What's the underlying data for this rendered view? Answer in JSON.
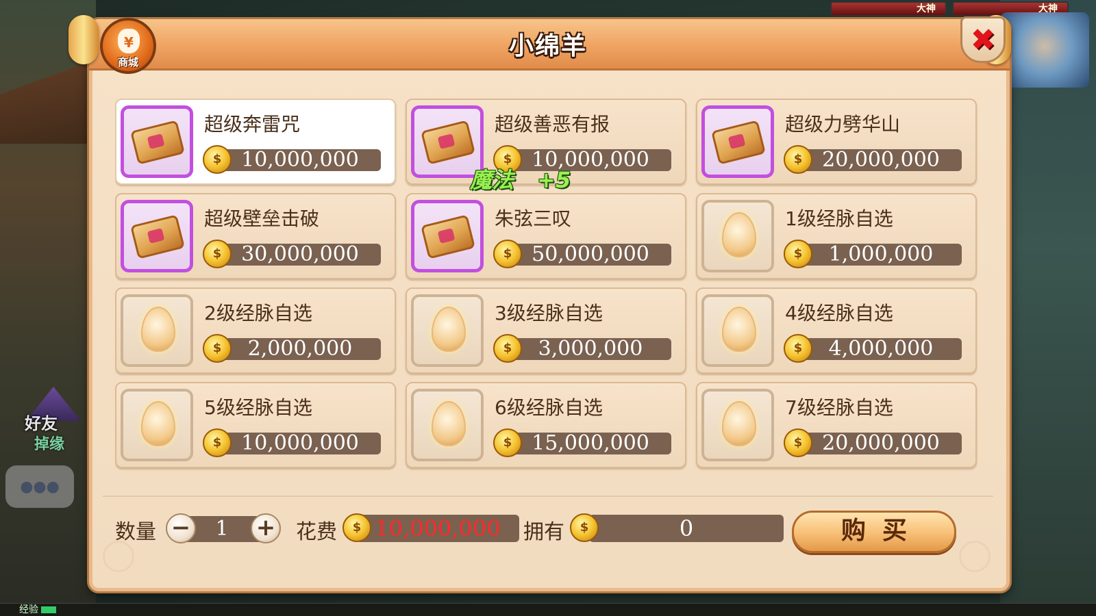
{
  "background": {
    "hp_bars": [
      "大神",
      "大神"
    ],
    "friend_label": "好友",
    "friend_sub": "掉缘",
    "exp_label": "经验"
  },
  "dialog": {
    "title": "小绵羊",
    "shop_badge_label": "商城",
    "shop_badge_symbol": "¥",
    "close_symbol": "✖"
  },
  "items": [
    {
      "name": "超级奔雷咒",
      "price": "10,000,000",
      "icon": "scroll-icon",
      "rarity": "purple",
      "selected": true
    },
    {
      "name": "超级善恶有报",
      "price": "10,000,000",
      "icon": "scroll-icon",
      "rarity": "purple",
      "selected": false
    },
    {
      "name": "超级力劈华山",
      "price": "20,000,000",
      "icon": "scroll-icon",
      "rarity": "purple",
      "selected": false
    },
    {
      "name": "超级壁垒击破",
      "price": "30,000,000",
      "icon": "scroll-icon",
      "rarity": "purple",
      "selected": false
    },
    {
      "name": "朱弦三叹",
      "price": "50,000,000",
      "icon": "scroll-icon",
      "rarity": "purple",
      "selected": false
    },
    {
      "name": "1级经脉自选",
      "price": "1,000,000",
      "icon": "egg-icon",
      "rarity": "plain",
      "selected": false
    },
    {
      "name": "2级经脉自选",
      "price": "2,000,000",
      "icon": "egg-icon",
      "rarity": "plain",
      "selected": false
    },
    {
      "name": "3级经脉自选",
      "price": "3,000,000",
      "icon": "egg-icon",
      "rarity": "plain",
      "selected": false
    },
    {
      "name": "4级经脉自选",
      "price": "4,000,000",
      "icon": "egg-icon",
      "rarity": "plain",
      "selected": false
    },
    {
      "name": "5级经脉自选",
      "price": "10,000,000",
      "icon": "egg-icon",
      "rarity": "plain",
      "selected": false
    },
    {
      "name": "6级经脉自选",
      "price": "15,000,000",
      "icon": "egg-icon",
      "rarity": "plain",
      "selected": false
    },
    {
      "name": "7级经脉自选",
      "price": "20,000,000",
      "icon": "egg-icon",
      "rarity": "plain",
      "selected": false
    }
  ],
  "float_text": {
    "label": "魔法",
    "value": "+5"
  },
  "footer": {
    "quantity_label": "数量",
    "quantity_value": "1",
    "minus_symbol": "−",
    "plus_symbol": "+",
    "cost_label": "花费",
    "cost_value": "10,000,000",
    "own_label": "拥有",
    "own_value": "0",
    "buy_label": "购买"
  },
  "colors": {
    "purple_frame": "#c24fe0",
    "cost_text": "#ff2a2a",
    "title_band": "#efa362",
    "panel": "#f4e0c4"
  }
}
